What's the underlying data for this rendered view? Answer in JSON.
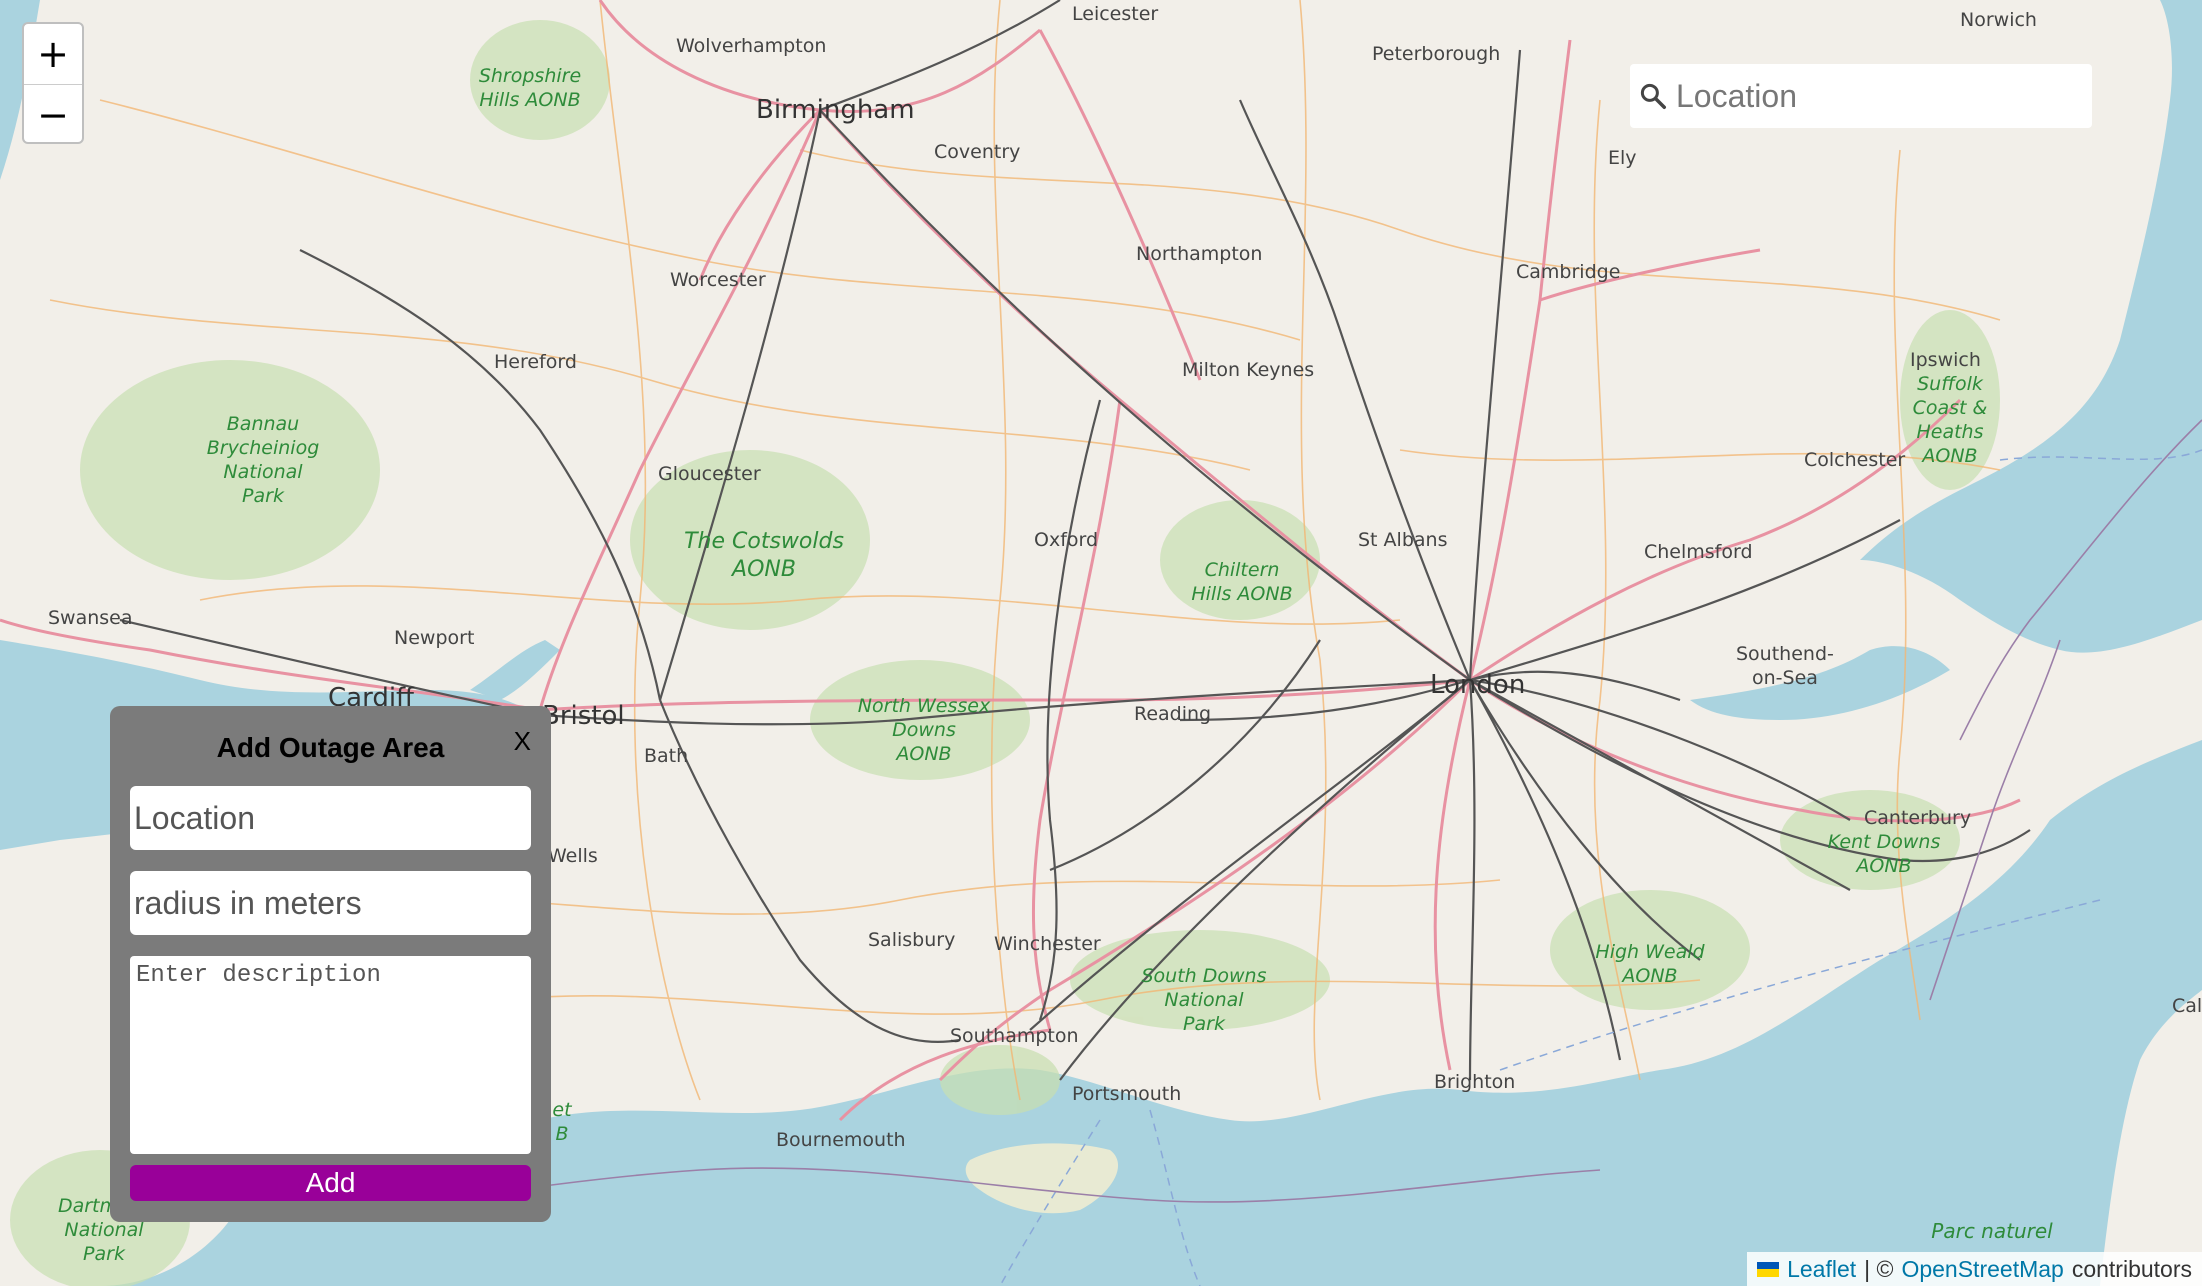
{
  "map": {
    "zoom_in_label": "+",
    "zoom_out_label": "−",
    "colors": {
      "land": "#f2efe9",
      "sea": "#aad3df",
      "motorway": "#e892a2",
      "rail": "#555555",
      "park": "#c8dfb0"
    },
    "places": {
      "leicester": "Leicester",
      "norwich": "Norwich",
      "wolverhampton": "Wolverhampton",
      "peterborough": "Peterborough",
      "birmingham": "Birmingham",
      "coventry": "Coventry",
      "ely": "Ely",
      "northampton": "Northampton",
      "cambridge": "Cambridge",
      "worcester": "Worcester",
      "hereford": "Hereford",
      "milton_keynes": "Milton Keynes",
      "ipswich": "Ipswich",
      "colchester": "Colchester",
      "gloucester": "Gloucester",
      "oxford": "Oxford",
      "st_albans": "St Albans",
      "chelmsford": "Chelmsford",
      "swansea": "Swansea",
      "newport": "Newport",
      "london": "London",
      "southend": "Southend-",
      "southend2": "on-Sea",
      "cardiff": "Cardiff",
      "bristol": "Bristol",
      "reading": "Reading",
      "bath": "Bath",
      "canterbury": "Canterbury",
      "wells": "Wells",
      "salisbury": "Salisbury",
      "winchester": "Winchester",
      "southampton": "Southampton",
      "brighton": "Brighton",
      "portsmouth": "Portsmouth",
      "bournemouth": "Bournemouth",
      "cal": "Cal"
    },
    "aonb": {
      "shropshire1": "Shropshire",
      "shropshire2": "Hills AONB",
      "bannau1": "Bannau",
      "bannau2": "Brycheiniog",
      "bannau3": "National",
      "bannau4": "Park",
      "cotswolds1": "The Cotswolds",
      "cotswolds2": "AONB",
      "chiltern1": "Chiltern",
      "chiltern2": "Hills AONB",
      "suffolk1": "Suffolk",
      "suffolk2": "Coast &",
      "suffolk3": "Heaths",
      "suffolk4": "AONB",
      "wessex1": "North Wessex",
      "wessex2": "Downs",
      "wessex3": "AONB",
      "kent1": "Kent Downs",
      "kent2": "AONB",
      "weald1": "High Weald",
      "weald2": "AONB",
      "sdowns1": "South Downs",
      "sdowns2": "National",
      "sdowns3": "Park",
      "dartmoor1": "Dartm",
      "dartmoor2": "National",
      "dartmoor3": "Park",
      "et": "et",
      "b": "B",
      "parc": "Parc naturel"
    }
  },
  "search": {
    "placeholder": "Location",
    "icon": "search-icon"
  },
  "panel": {
    "title": "Add Outage Area",
    "close_label": "X",
    "location_placeholder": "Location",
    "radius_placeholder": "radius in meters",
    "description_placeholder": "Enter description",
    "add_label": "Add",
    "add_color": "#990099"
  },
  "attribution": {
    "leaflet": "Leaflet",
    "separator": "| ©",
    "osm": "OpenStreetMap",
    "contributors": "contributors"
  }
}
